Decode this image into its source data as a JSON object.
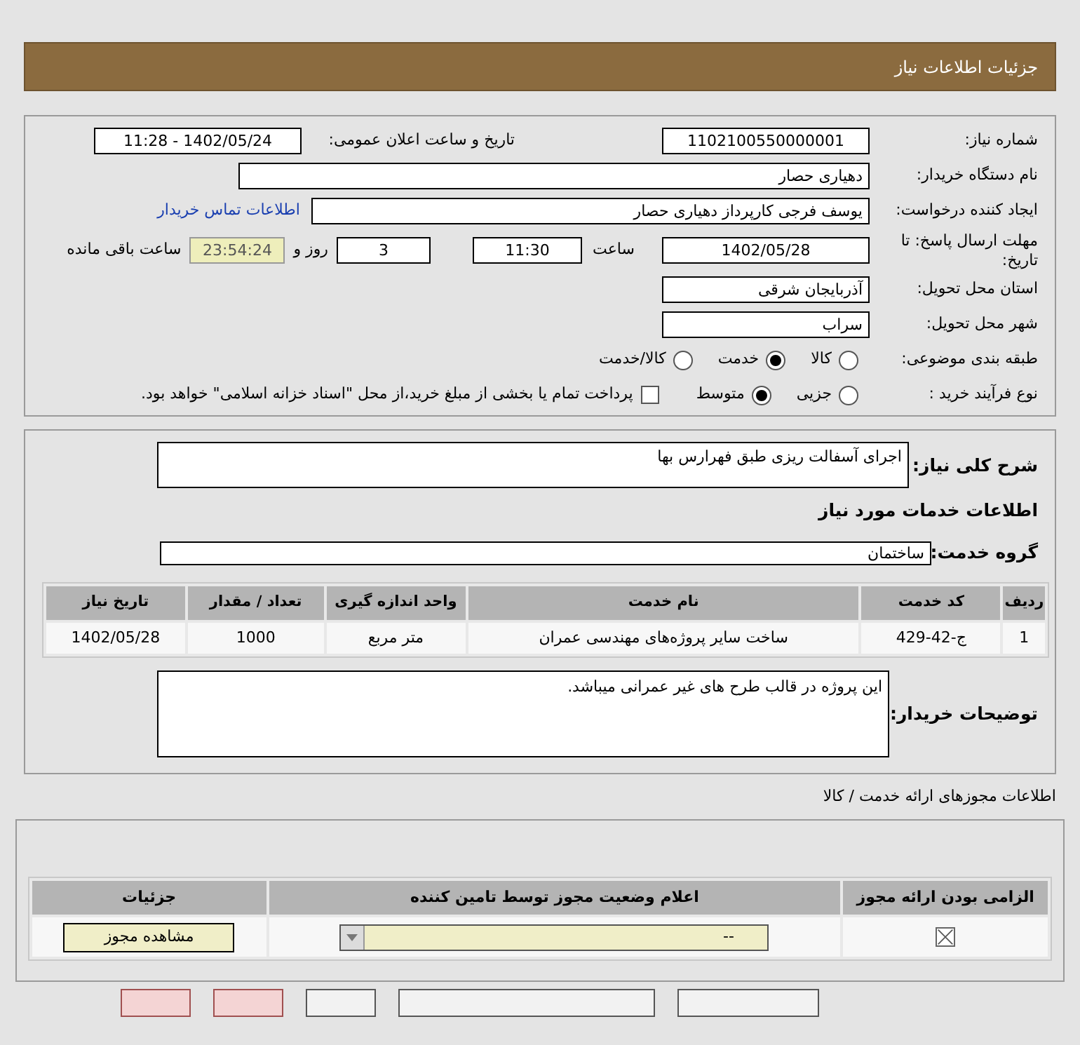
{
  "header": {
    "title": "جزئیات اطلاعات نیاز"
  },
  "need_number": {
    "label": "شماره نیاز:",
    "value": "1102100550000001"
  },
  "announce": {
    "label": "تاریخ و ساعت اعلان عمومی:",
    "value": "1402/05/24 - 11:28"
  },
  "buyer_org": {
    "label": "نام دستگاه خریدار:",
    "value": "دهیاری حصار"
  },
  "requester": {
    "label": "ایجاد کننده درخواست:",
    "value": "یوسف فرجی کارپرداز دهیاری حصار",
    "link": "اطلاعات تماس خریدار"
  },
  "deadline": {
    "label": "مهلت ارسال پاسخ: تا تاریخ:",
    "date": "1402/05/28",
    "time_label": "ساعت",
    "time": "11:30",
    "days": "3",
    "days_label": "روز و",
    "remaining": "23:54:24",
    "remaining_label": "ساعت باقی مانده"
  },
  "province": {
    "label": "استان محل تحویل:",
    "value": "آذربایجان شرقی"
  },
  "city": {
    "label": "شهر محل تحویل:",
    "value": "سراب"
  },
  "category": {
    "label": "طبقه بندی موضوعی:",
    "options": [
      {
        "label": "کالا",
        "selected": false
      },
      {
        "label": "خدمت",
        "selected": true
      },
      {
        "label": "کالا/خدمت",
        "selected": false
      }
    ]
  },
  "purchase_process": {
    "label": "نوع فرآیند خرید :",
    "options": [
      {
        "label": "جزیی",
        "selected": false
      },
      {
        "label": "متوسط",
        "selected": true
      }
    ],
    "payment": {
      "label": "پرداخت تمام یا بخشی از مبلغ خرید،از محل \"اسناد خزانه اسلامی\" خواهد بود.",
      "checked": false
    }
  },
  "description": {
    "label": "شرح کلی نیاز:",
    "value": "اجرای آسفالت ریزی طبق فهرارس بها"
  },
  "services_title": "اطلاعات خدمات مورد نیاز",
  "service_group": {
    "label": "گروه خدمت:",
    "value": "ساختمان"
  },
  "services_table": {
    "columns": [
      "ردیف",
      "کد خدمت",
      "نام خدمت",
      "واحد اندازه گیری",
      "تعداد / مقدار",
      "تاریخ نیاز"
    ],
    "rows": [
      [
        "1",
        "ج-42-429",
        "ساخت سایر پروژه‌های مهندسی عمران",
        "متر مربع",
        "1000",
        "1402/05/28"
      ]
    ]
  },
  "buyer_notes": {
    "label": "توضیحات خریدار:",
    "value": "این پروژه در قالب طرح های غیر عمرانی میباشد."
  },
  "permits_title": "اطلاعات مجوزهای ارائه خدمت / کالا",
  "permits_table": {
    "columns": [
      "الزامی بودن ارائه مجوز",
      "اعلام وضعیت مجوز توسط تامین کننده",
      "جزئیات"
    ],
    "rows": [
      {
        "required": true,
        "status": "--",
        "details_button": "مشاهده مجوز"
      }
    ]
  },
  "bottom_buttons": [
    {
      "kind": "plain"
    },
    {
      "kind": "plain"
    },
    {
      "kind": "plain"
    },
    {
      "kind": "danger"
    },
    {
      "kind": "danger"
    }
  ]
}
